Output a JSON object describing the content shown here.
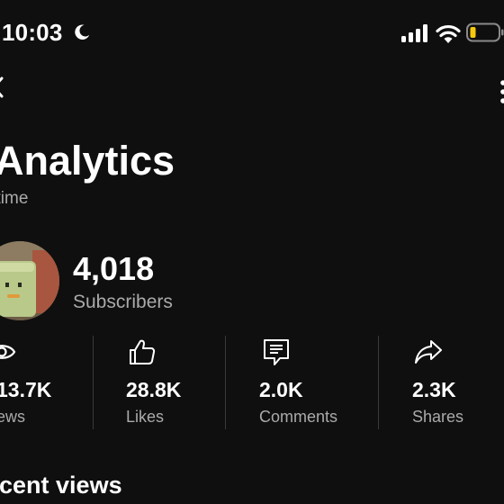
{
  "status_bar": {
    "time": "10:03",
    "battery_color": "#f6c90e"
  },
  "header": {
    "title": "Analytics",
    "subtitle": "l time"
  },
  "channel": {
    "subscribers_count": "4,018",
    "subscribers_label": "Subscribers"
  },
  "stats": [
    {
      "icon": "eye-icon",
      "value": "13.7K",
      "label": "ews"
    },
    {
      "icon": "thumbs-up-icon",
      "value": "28.8K",
      "label": "Likes"
    },
    {
      "icon": "comment-icon",
      "value": "2.0K",
      "label": "Comments"
    },
    {
      "icon": "share-icon",
      "value": "2.3K",
      "label": "Shares"
    }
  ],
  "section": {
    "recent_views": "ecent views"
  }
}
